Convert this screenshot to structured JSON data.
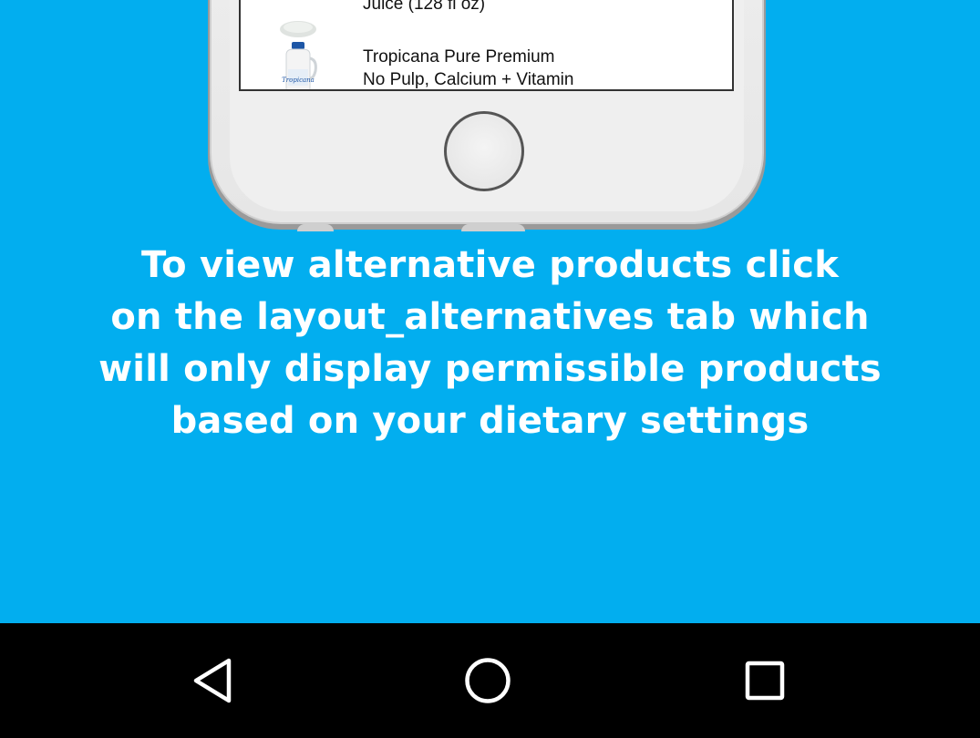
{
  "phone_mockup": {
    "products": [
      {
        "name_lines": "Juice (128 fl oz)",
        "icon": "juice-carton-icon"
      },
      {
        "name_lines": "Tropicana Pure Premium\nNo Pulp, Calcium + Vitamin",
        "icon": "tropicana-bottle-icon",
        "thumb_label": "Tropicana"
      }
    ]
  },
  "instruction": {
    "lines": [
      "To view alternative products click",
      "on the layout_alternatives tab which",
      "will only display permissible products",
      "based on your dietary settings"
    ]
  },
  "navbar": {
    "back_icon": "back-triangle-icon",
    "home_icon": "home-circle-icon",
    "recents_icon": "recents-square-icon"
  },
  "colors": {
    "background": "#02AEEF",
    "text": "#FFFFFF",
    "navbar": "#000000"
  }
}
